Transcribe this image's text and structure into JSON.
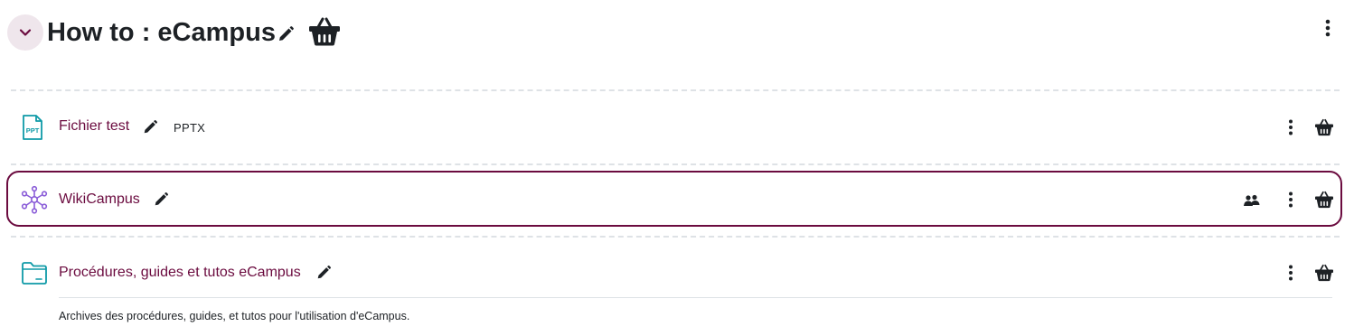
{
  "section": {
    "title": "How to : eCampus",
    "collapse_icon": "chevron-down-icon",
    "edit_icon": "pencil-icon",
    "basket_icon": "basket-icon",
    "menu_icon": "kebab-icon"
  },
  "activities": [
    {
      "name": "Fichier test",
      "type_icon": "ppt-file-icon",
      "icon_label": "PPT",
      "badge": "PPTX"
    },
    {
      "name": "WikiCampus",
      "type_icon": "wiki-network-icon",
      "group_icon": "groups-icon",
      "highlighted": true
    },
    {
      "name": "Procédures, guides et tutos eCampus",
      "type_icon": "folder-icon",
      "description": "Archives des procédures, guides, et tutos pour l'utilisation d'eCampus."
    }
  ],
  "colors": {
    "link": "#6b0b3f",
    "resource_teal": "#0e9aa7",
    "collaboration_purple": "#8a5cd8",
    "highlight_border": "#6b0b3f",
    "collapse_bg": "#efe6ec",
    "divider": "#dee2e6"
  }
}
